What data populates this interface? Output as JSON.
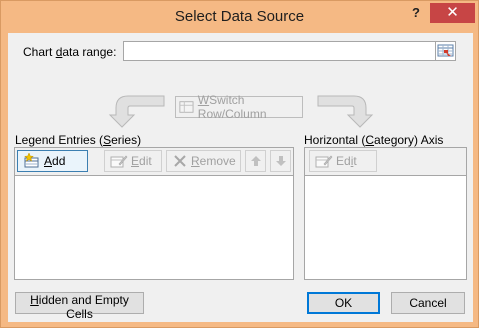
{
  "window": {
    "title": "Select Data Source",
    "help_label": "?",
    "close_label": "✕"
  },
  "range": {
    "label_pre": "Chart ",
    "label_accel": "d",
    "label_post": "ata range:",
    "value": ""
  },
  "switch_button": {
    "accel": "W",
    "rest": "Switch Row/Column"
  },
  "legend": {
    "label_pre": "Legend Entries (",
    "label_accel": "S",
    "label_post": "eries)",
    "add_accel": "A",
    "add_rest": "dd",
    "edit_accel": "E",
    "edit_rest": "dit",
    "remove_accel": "R",
    "remove_rest": "emove",
    "items": []
  },
  "axis": {
    "label_pre": "Horizontal (",
    "label_accel": "C",
    "label_post": "ategory) Axis Labels",
    "edit_pre": "Ed",
    "edit_accel": "i",
    "edit_post": "t",
    "items": []
  },
  "footer": {
    "hidden_accel": "H",
    "hidden_rest": "idden and Empty Cells",
    "ok_label": "OK",
    "cancel_label": "Cancel"
  },
  "colors": {
    "title_bar": "#f5b984",
    "close_button": "#c74545",
    "client_bg": "#f0f0f0"
  }
}
